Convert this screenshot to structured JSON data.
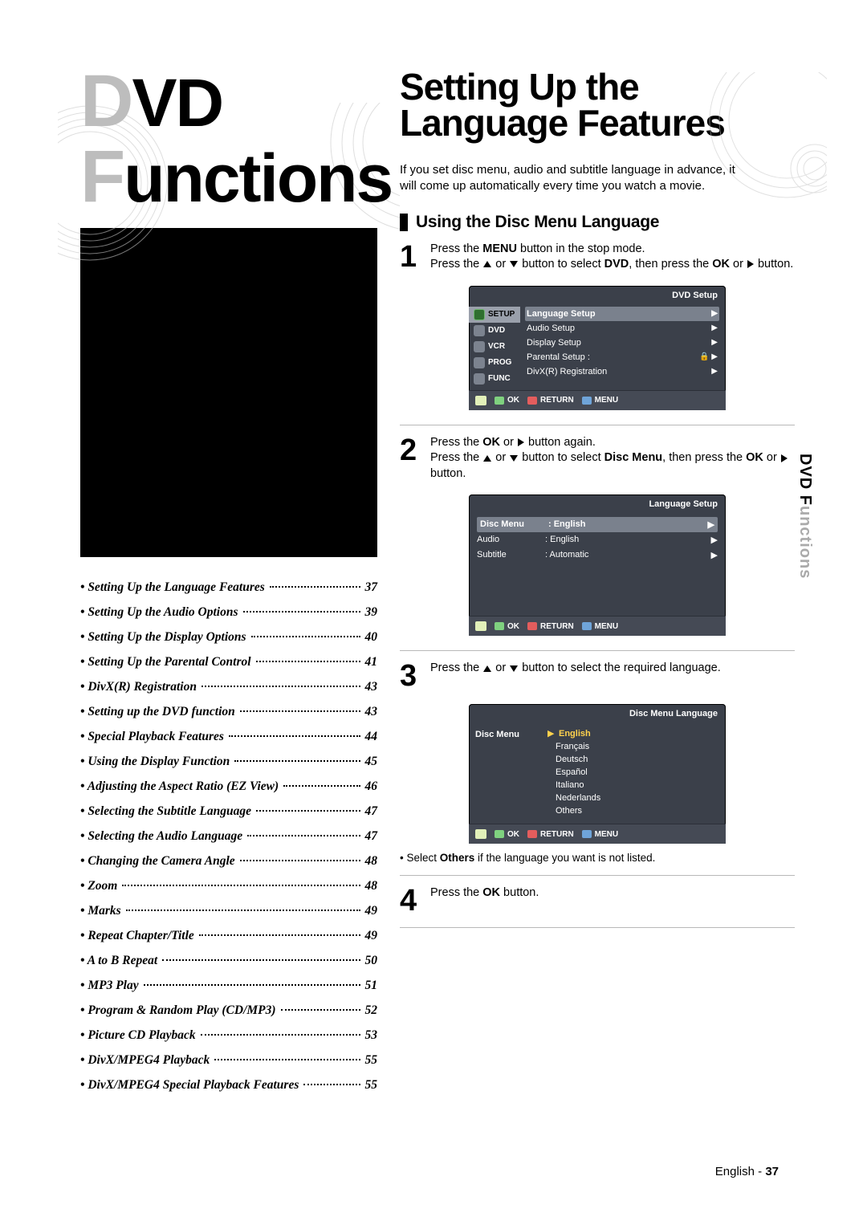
{
  "leftTitle": {
    "dvd_d": "D",
    "dvd_vd": "VD",
    "f": "F",
    "unctions": "unctions"
  },
  "toc": [
    {
      "label": "Setting Up the Language Features",
      "page": "37"
    },
    {
      "label": "Setting Up the Audio Options",
      "page": "39"
    },
    {
      "label": "Setting Up the Display Options",
      "page": "40"
    },
    {
      "label": "Setting Up the Parental Control",
      "page": "41"
    },
    {
      "label": "DivX(R) Registration",
      "page": "43"
    },
    {
      "label": "Setting up the DVD function",
      "page": "43"
    },
    {
      "label": "Special Playback Features",
      "page": "44"
    },
    {
      "label": "Using the Display Function",
      "page": "45"
    },
    {
      "label": "Adjusting the Aspect Ratio (EZ View)",
      "page": "46"
    },
    {
      "label": "Selecting the Subtitle Language",
      "page": "47"
    },
    {
      "label": "Selecting the Audio Language",
      "page": "47"
    },
    {
      "label": "Changing the Camera Angle",
      "page": "48"
    },
    {
      "label": "Zoom",
      "page": "48"
    },
    {
      "label": "Marks",
      "page": "49"
    },
    {
      "label": "Repeat Chapter/Title",
      "page": "49"
    },
    {
      "label": "A to B Repeat",
      "page": "50"
    },
    {
      "label": "MP3 Play",
      "page": "51"
    },
    {
      "label": "Program & Random Play (CD/MP3)",
      "page": "52"
    },
    {
      "label": "Picture CD Playback",
      "page": "53"
    },
    {
      "label": "DivX/MPEG4 Playback",
      "page": "55"
    },
    {
      "label": "DivX/MPEG4 Special Playback Features",
      "page": "55"
    }
  ],
  "rightTitle": {
    "l1": "Setting Up the",
    "l2": "Language Features"
  },
  "intro": "If you set disc menu, audio and subtitle language in advance, it will come up automatically every time you watch a movie.",
  "subheading": "Using the Disc Menu Language",
  "steps": {
    "1": {
      "a": "Press the ",
      "b": "MENU",
      "c": " button in the stop mode.",
      "d": "Press the ",
      "e": " or ",
      "f": " button to select ",
      "g": "DVD",
      "h": ", then press the ",
      "i": "OK",
      "j": " or ",
      "k": " button."
    },
    "2": {
      "a": "Press the ",
      "b": "OK",
      "c": " or ",
      "d": " button again.",
      "e": "Press the ",
      "f": " or ",
      "g": " button to select ",
      "h": "Disc Menu",
      "i": ", then press the ",
      "j": "OK",
      "k": " or ",
      "l": " button."
    },
    "3": {
      "a": "Press the ",
      "b": " or ",
      "c": " button to select the required language."
    },
    "4": {
      "a": "Press the ",
      "b": "OK",
      "c": "  button."
    }
  },
  "note": {
    "a": "Select ",
    "b": "Others",
    "c": " if the language you want is not listed."
  },
  "osd1": {
    "title": "DVD  Setup",
    "side": [
      "SETUP",
      "DVD",
      "VCR",
      "PROG",
      "FUNC"
    ],
    "menu": [
      {
        "t": "Language Setup",
        "sel": true
      },
      {
        "t": "Audio Setup"
      },
      {
        "t": "Display Setup"
      },
      {
        "t": "Parental Setup :",
        "lock": true
      },
      {
        "t": "DivX(R) Registration"
      }
    ],
    "bot": {
      "ok": "OK",
      "ret": "RETURN",
      "menu": "MENU"
    }
  },
  "osd2": {
    "title": "Language Setup",
    "rows": [
      {
        "l": "Disc Menu",
        "v": ": English",
        "sel": true,
        "arrow": true
      },
      {
        "l": "Audio",
        "v": ": English",
        "arrow": true
      },
      {
        "l": "Subtitle",
        "v": ": Automatic",
        "arrow": true
      }
    ],
    "bot": {
      "ok": "OK",
      "ret": "RETURN",
      "menu": "MENU"
    }
  },
  "osd3": {
    "title": "Disc Menu Language",
    "label": "Disc Menu",
    "opts": [
      "English",
      "Français",
      "Deutsch",
      "Español",
      "Italiano",
      "Nederlands",
      "Others"
    ],
    "bot": {
      "ok": "OK",
      "ret": "RETURN",
      "menu": "MENU"
    }
  },
  "footer": {
    "lang": "English",
    "dash": " - ",
    "page": "37"
  },
  "sideTab": {
    "d": "DVD F",
    "r": "unctions"
  }
}
